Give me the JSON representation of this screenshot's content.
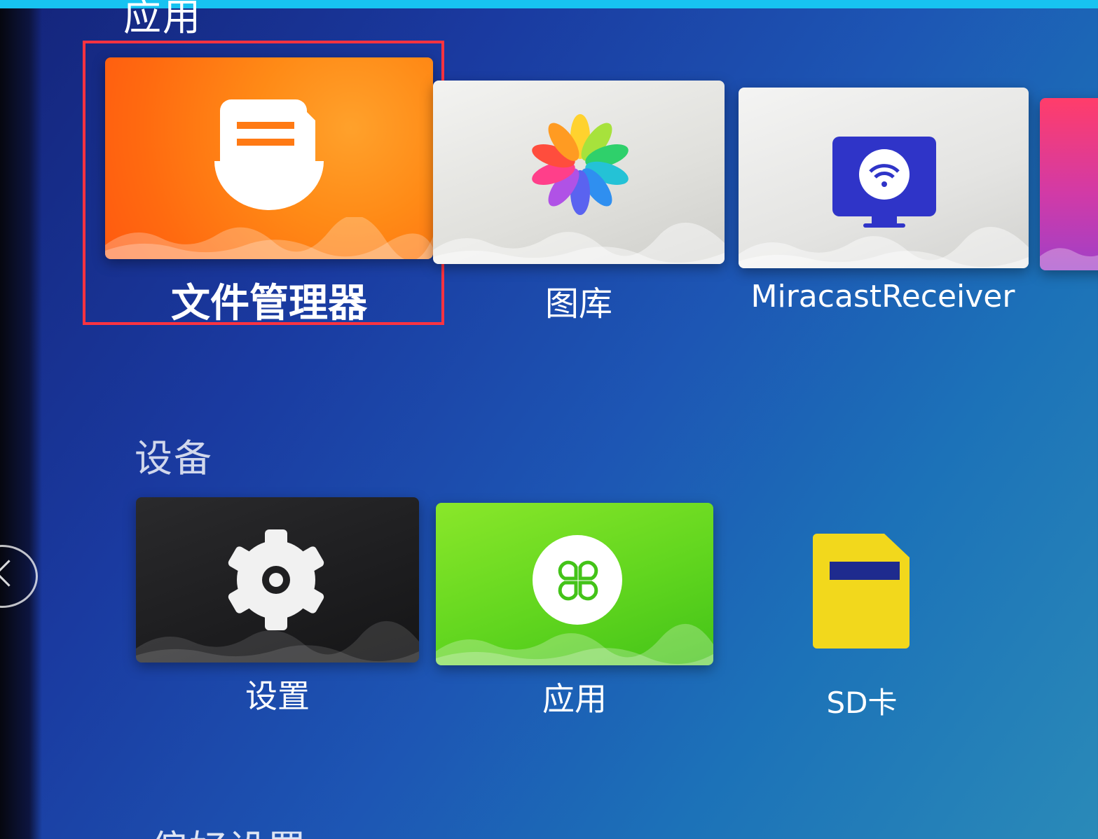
{
  "sections": {
    "apps": "应用",
    "devices": "设备",
    "preferences": "偏好设置"
  },
  "apps_row": [
    {
      "label": "文件管理器",
      "icon": "file-manager-icon",
      "color": "#ff7a14",
      "focused": true
    },
    {
      "label": "图库",
      "icon": "gallery-pinwheel-icon",
      "color": "#e6e6e3"
    },
    {
      "label": "MiracastReceiver",
      "icon": "miracast-monitor-icon",
      "color": "#e8e8e6"
    }
  ],
  "devices_row": [
    {
      "label": "设置",
      "icon": "gear-icon",
      "color": "#1f1f21"
    },
    {
      "label": "应用",
      "icon": "apps-clover-icon",
      "color": "#62d61f"
    },
    {
      "label": "SD卡",
      "icon": "sd-card-icon",
      "color": "#f2d81c"
    }
  ],
  "colors": {
    "focus_border": "#ff3340",
    "top_strip": "#17c3f1",
    "background": "#1a3aa0"
  }
}
